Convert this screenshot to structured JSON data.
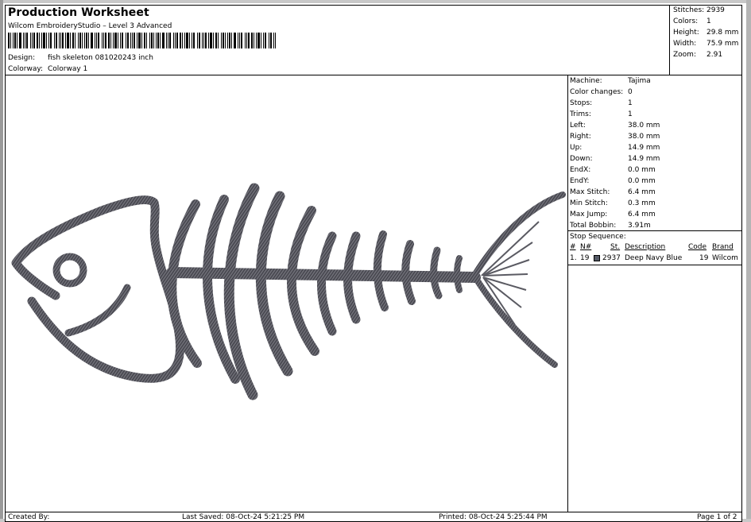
{
  "title": "Production Worksheet",
  "subtitle": "Wilcom EmbroideryStudio – Level 3 Advanced",
  "design": {
    "label": "Design:",
    "value": "fish skeleton 081020243 inch"
  },
  "colorway": {
    "label": "Colorway:",
    "value": "Colorway 1"
  },
  "summary": [
    {
      "label": "Stitches:",
      "value": "2939"
    },
    {
      "label": "Colors:",
      "value": "1"
    },
    {
      "label": "Height:",
      "value": "29.8 mm"
    },
    {
      "label": "Width:",
      "value": "75.9 mm"
    },
    {
      "label": "Zoom:",
      "value": "2.91"
    }
  ],
  "details": [
    {
      "label": "Machine:",
      "value": "Tajima"
    },
    {
      "label": "Color changes:",
      "value": "0"
    },
    {
      "label": "Stops:",
      "value": "1"
    },
    {
      "label": "Trims:",
      "value": "1"
    },
    {
      "label": "Left:",
      "value": "38.0 mm"
    },
    {
      "label": "Right:",
      "value": "38.0 mm"
    },
    {
      "label": "Up:",
      "value": "14.9 mm"
    },
    {
      "label": "Down:",
      "value": "14.9 mm"
    },
    {
      "label": "EndX:",
      "value": "0.0 mm"
    },
    {
      "label": "EndY:",
      "value": "0.0 mm"
    },
    {
      "label": "Max Stitch:",
      "value": "6.4 mm"
    },
    {
      "label": "Min Stitch:",
      "value": "0.3 mm"
    },
    {
      "label": "Max Jump:",
      "value": "6.4 mm"
    },
    {
      "label": "Total Bobbin:",
      "value": "3.91m"
    }
  ],
  "stop_sequence": {
    "label": "Stop Sequence:",
    "headers": {
      "num": "#",
      "n": "N#",
      "st": "St.",
      "description": "Description",
      "code": "Code",
      "brand": "Brand"
    },
    "rows": [
      {
        "num": "1.",
        "n": "19",
        "st": "2937",
        "description": "Deep Navy Blue",
        "code": "19",
        "brand": "Wilcom",
        "color": "#555a66"
      }
    ]
  },
  "thread_color": "#5a5a62",
  "footer": {
    "created_by": "Created By:",
    "last_saved": "Last Saved: 08-Oct-24 5:21:25 PM",
    "printed": "Printed: 08-Oct-24 5:25:44 PM",
    "page": "Page 1 of 2"
  }
}
